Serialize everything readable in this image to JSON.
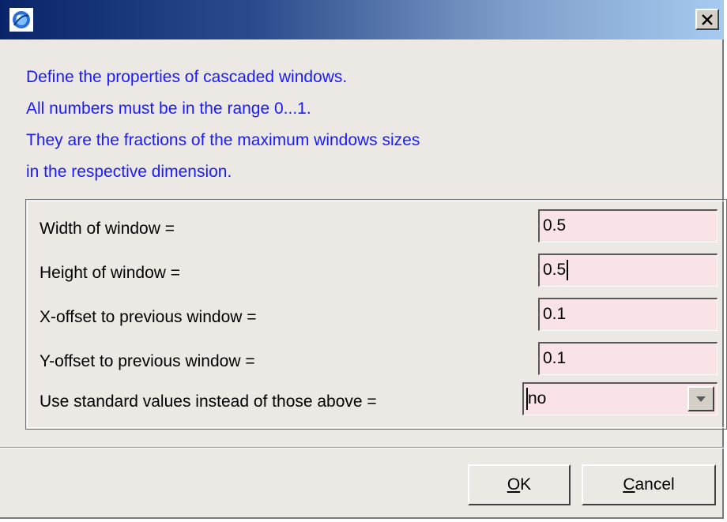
{
  "window": {
    "close_symbol": "×"
  },
  "info": {
    "lines": [
      "Define the properties of cascaded windows.",
      "All numbers must be in the range 0...1.",
      "They are the fractions of the maximum windows sizes",
      "in the respective dimension."
    ],
    "color": "#1a1aff"
  },
  "form": {
    "width": {
      "label": "Width of window =",
      "value": "0.5"
    },
    "height": {
      "label": "Height of window =",
      "value": "0.5"
    },
    "x_offset": {
      "label": "X-offset to previous window =",
      "value": "0.1"
    },
    "y_offset": {
      "label": "Y-offset to previous window =",
      "value": "0.1"
    },
    "standard": {
      "label": "Use standard values instead of those above =",
      "selected": "no"
    }
  },
  "buttons": {
    "ok": {
      "mnemonic": "O",
      "rest": "K"
    },
    "cancel": {
      "mnemonic": "C",
      "rest": "ancel"
    }
  },
  "colors": {
    "field_bg": "#f9e3e6",
    "title_gradient_start": "#0a246a",
    "title_gradient_end": "#a6caf0"
  },
  "icons": {
    "app": "app-logo-icon",
    "close": "close-icon",
    "dropdown": "chevron-down-icon"
  }
}
